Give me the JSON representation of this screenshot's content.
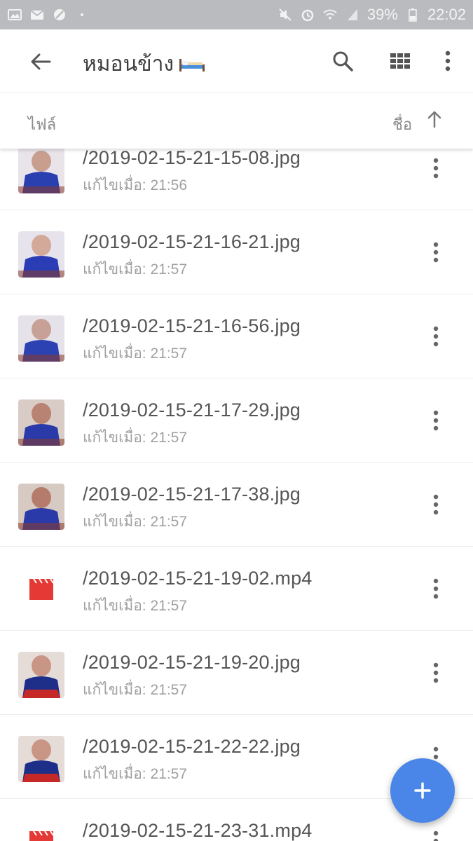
{
  "status_bar": {
    "battery": "39%",
    "time": "22:02",
    "icons_left": [
      "image-icon",
      "mail-icon",
      "blocked-icon",
      "dot-icon"
    ],
    "icons_right": [
      "mute-icon",
      "alarm-icon",
      "wifi-icon",
      "signal-icon",
      "battery-icon"
    ]
  },
  "app_bar": {
    "title": "หมอนข้าง",
    "title_emoji_icon": "bed-icon",
    "actions": [
      "search-icon",
      "grid-view-icon",
      "more-vert-icon"
    ]
  },
  "sort_header": {
    "files_label": "ไฟล์",
    "sort_by_label": "ชื่อ",
    "sort_direction_icon": "arrow-up-icon"
  },
  "files": [
    {
      "name": "/2019-02-15-21-15-08.jpg",
      "meta": "แก้ไขเมื่อ: 21:56",
      "type": "image"
    },
    {
      "name": "/2019-02-15-21-16-21.jpg",
      "meta": "แก้ไขเมื่อ: 21:57",
      "type": "image"
    },
    {
      "name": "/2019-02-15-21-16-56.jpg",
      "meta": "แก้ไขเมื่อ: 21:57",
      "type": "image"
    },
    {
      "name": "/2019-02-15-21-17-29.jpg",
      "meta": "แก้ไขเมื่อ: 21:57",
      "type": "image"
    },
    {
      "name": "/2019-02-15-21-17-38.jpg",
      "meta": "แก้ไขเมื่อ: 21:57",
      "type": "image"
    },
    {
      "name": "/2019-02-15-21-19-02.mp4",
      "meta": "แก้ไขเมื่อ: 21:57",
      "type": "video"
    },
    {
      "name": "/2019-02-15-21-19-20.jpg",
      "meta": "แก้ไขเมื่อ: 21:57",
      "type": "image"
    },
    {
      "name": "/2019-02-15-21-22-22.jpg",
      "meta": "แก้ไขเมื่อ: 21:57",
      "type": "image"
    },
    {
      "name": "/2019-02-15-21-23-31.mp4",
      "meta": "",
      "type": "video"
    }
  ],
  "fab": {
    "icon": "plus-icon"
  },
  "colors": {
    "status_bar": "#b9bbbe",
    "fab": "#4a86e8",
    "video_icon": "#e53935",
    "thumb_blue": "#2a3fb0"
  }
}
